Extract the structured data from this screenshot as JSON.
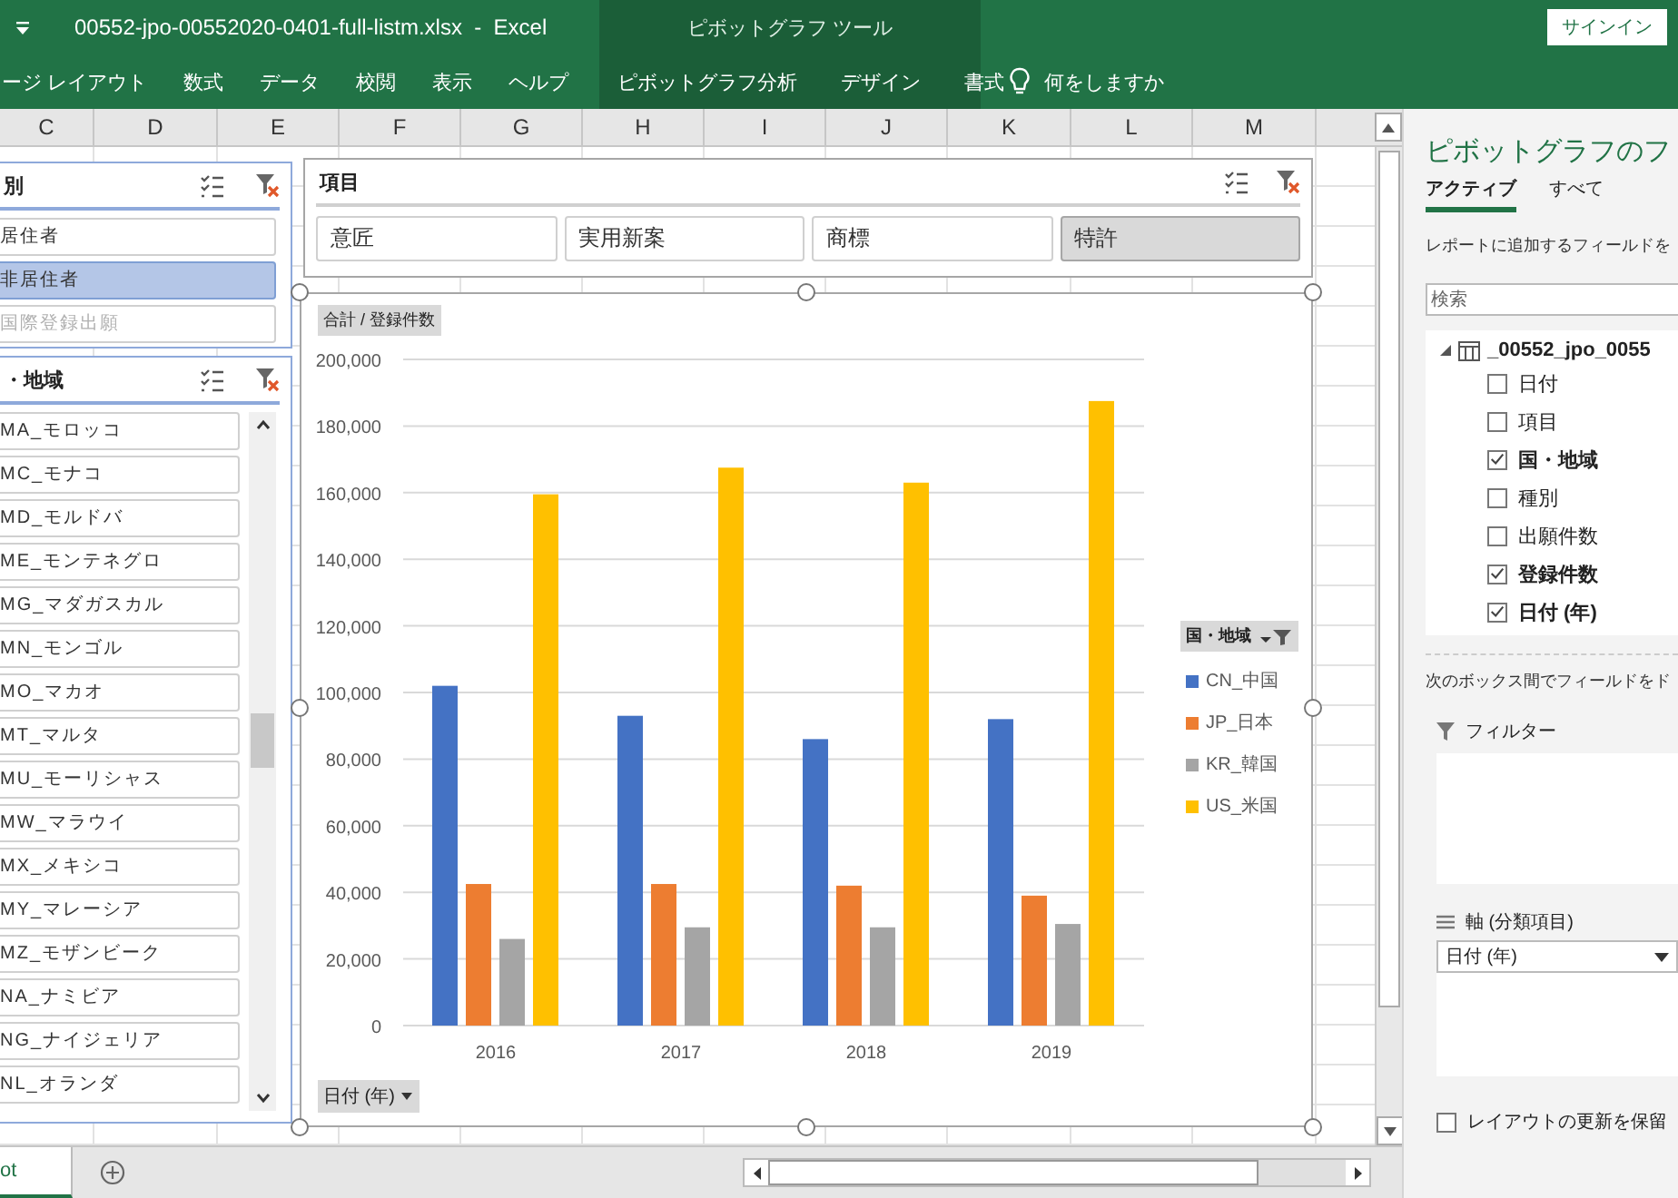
{
  "window": {
    "title": "00552-jpo-00552020-0401-full-listm.xlsx  -  Excel",
    "context_group": "ピボットグラフ ツール",
    "sign_in": "サインイン"
  },
  "ribbon_tabs": [
    {
      "label": "ージ レイアウト",
      "contextual": false
    },
    {
      "label": "数式",
      "contextual": false
    },
    {
      "label": "データ",
      "contextual": false
    },
    {
      "label": "校閲",
      "contextual": false
    },
    {
      "label": "表示",
      "contextual": false
    },
    {
      "label": "ヘルプ",
      "contextual": false
    },
    {
      "label": "ピボットグラフ分析",
      "contextual": true
    },
    {
      "label": "デザイン",
      "contextual": true
    },
    {
      "label": "書式",
      "contextual": true
    }
  ],
  "tell_me": "何をしますか",
  "columns": [
    "C",
    "D",
    "E",
    "F",
    "G",
    "H",
    "I",
    "J",
    "K",
    "L",
    "M"
  ],
  "slicers": [
    {
      "title": "別",
      "items": [
        {
          "label": "居住者",
          "selected": false,
          "disabled": false
        },
        {
          "label": "非居住者",
          "selected": true,
          "disabled": false
        },
        {
          "label": "国際登録出願",
          "selected": false,
          "disabled": true
        }
      ]
    },
    {
      "title": "・地域",
      "items": [
        {
          "label": "MA_モロッコ",
          "selected": false,
          "disabled": false
        },
        {
          "label": "MC_モナコ",
          "selected": false,
          "disabled": false
        },
        {
          "label": "MD_モルドバ",
          "selected": false,
          "disabled": false
        },
        {
          "label": "ME_モンテネグロ",
          "selected": false,
          "disabled": false
        },
        {
          "label": "MG_マダガスカル",
          "selected": false,
          "disabled": false
        },
        {
          "label": "MN_モンゴル",
          "selected": false,
          "disabled": false
        },
        {
          "label": "MO_マカオ",
          "selected": false,
          "disabled": false
        },
        {
          "label": "MT_マルタ",
          "selected": false,
          "disabled": false
        },
        {
          "label": "MU_モーリシャス",
          "selected": false,
          "disabled": false
        },
        {
          "label": "MW_マラウイ",
          "selected": false,
          "disabled": false
        },
        {
          "label": "MX_メキシコ",
          "selected": false,
          "disabled": false
        },
        {
          "label": "MY_マレーシア",
          "selected": false,
          "disabled": false
        },
        {
          "label": "MZ_モザンビーク",
          "selected": false,
          "disabled": false
        },
        {
          "label": "NA_ナミビア",
          "selected": false,
          "disabled": false
        },
        {
          "label": "NG_ナイジェリア",
          "selected": false,
          "disabled": false
        },
        {
          "label": "NL_オランダ",
          "selected": false,
          "disabled": false
        }
      ]
    }
  ],
  "item_slicer": {
    "title": "項目",
    "items": [
      {
        "label": "意匠",
        "selected": false
      },
      {
        "label": "実用新案",
        "selected": false
      },
      {
        "label": "商標",
        "selected": false
      },
      {
        "label": "特許",
        "selected": true
      }
    ]
  },
  "chart": {
    "value_button": "合計 / 登録件数",
    "axis_button": "日付 (年)",
    "legend_button": "国・地域",
    "chart_data": {
      "type": "bar",
      "categories": [
        "2016",
        "2017",
        "2018",
        "2019"
      ],
      "series": [
        {
          "name": "CN_中国",
          "color": "#4472c4",
          "values": [
            102000,
            93000,
            86000,
            92000
          ]
        },
        {
          "name": "JP_日本",
          "color": "#ed7d31",
          "values": [
            42500,
            42500,
            42000,
            39000
          ]
        },
        {
          "name": "KR_韓国",
          "color": "#a5a5a5",
          "values": [
            26000,
            29500,
            29500,
            30500
          ]
        },
        {
          "name": "US_米国",
          "color": "#ffc000",
          "values": [
            159500,
            167500,
            163000,
            187500
          ]
        }
      ],
      "ylim": [
        0,
        200000
      ],
      "grid": true,
      "legend": true,
      "yticks": [
        {
          "value": 0,
          "label": "0"
        },
        {
          "value": 20000,
          "label": "20,000"
        },
        {
          "value": 40000,
          "label": "40,000"
        },
        {
          "value": 60000,
          "label": "60,000"
        },
        {
          "value": 80000,
          "label": "80,000"
        },
        {
          "value": 100000,
          "label": "100,000"
        },
        {
          "value": 120000,
          "label": "120,000"
        },
        {
          "value": 140000,
          "label": "140,000"
        },
        {
          "value": 160000,
          "label": "160,000"
        },
        {
          "value": 180000,
          "label": "180,000"
        },
        {
          "value": 200000,
          "label": "200,000"
        }
      ]
    }
  },
  "sheet_tab": "ot",
  "field_list": {
    "title": "ピボットグラフのフ",
    "tabs": [
      {
        "label": "アクティブ",
        "selected": true
      },
      {
        "label": "すべて",
        "selected": false
      }
    ],
    "hint": "レポートに追加するフィールドを",
    "search": {
      "placeholder": "検索"
    },
    "tree": [
      {
        "label": "_00552_jpo_0055",
        "expanded": true,
        "children": [
          {
            "label": "日付",
            "checked": false
          },
          {
            "label": "項目",
            "checked": false
          },
          {
            "label": "国・地域",
            "checked": true
          },
          {
            "label": "種別",
            "checked": false
          },
          {
            "label": "出願件数",
            "checked": false
          },
          {
            "label": "登録件数",
            "checked": true
          },
          {
            "label": "日付 (年)",
            "checked": true
          }
        ]
      }
    ],
    "areas_hint": "次のボックス間でフィールドをド",
    "filter_area": {
      "label": "フィルター"
    },
    "axis_area": {
      "label": "軸 (分類項目)",
      "fields": [
        "日付 (年)"
      ]
    },
    "defer_update": {
      "label": "レイアウトの更新を保留",
      "checked": false
    }
  }
}
